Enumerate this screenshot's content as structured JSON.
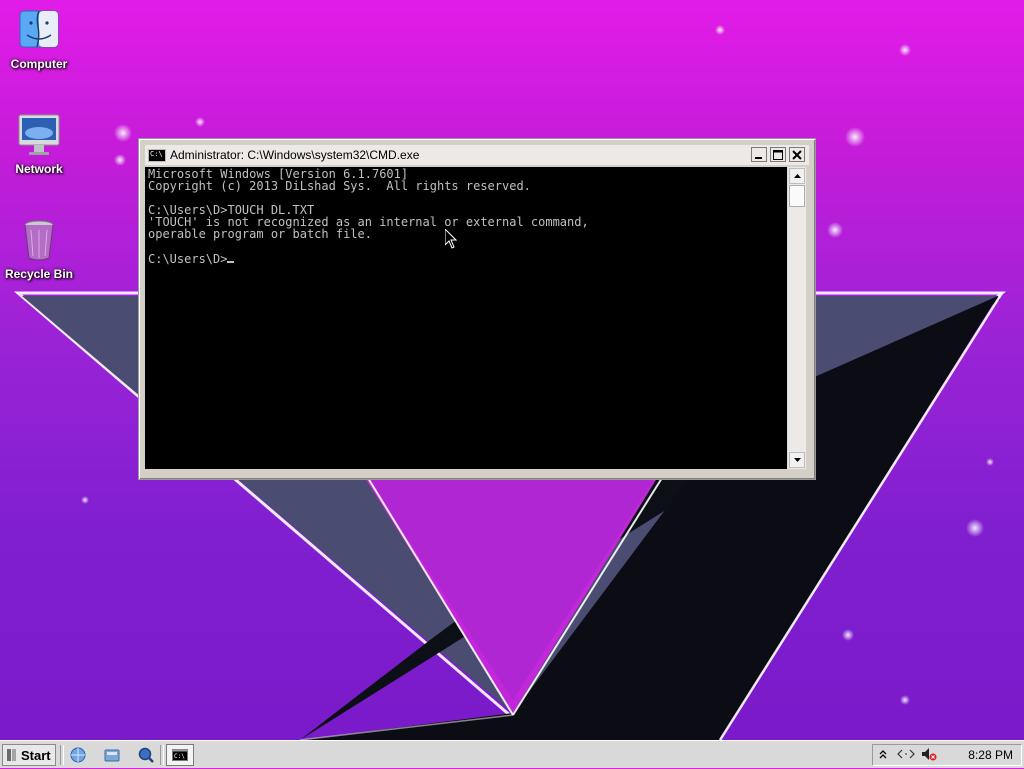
{
  "desktop": {
    "icons": [
      {
        "label": "Computer",
        "icon": "finder-computer-icon"
      },
      {
        "label": "Network",
        "icon": "imac-network-icon"
      },
      {
        "label": "Recycle Bin",
        "icon": "recycle-bin-icon"
      }
    ]
  },
  "window": {
    "title": "Administrator: C:\\Windows\\system32\\CMD.exe",
    "app_icon_text": "C:\\",
    "console_lines": [
      "Microsoft Windows [Version 6.1.7601]",
      "Copyright (c) 2013 DiLshad Sys.  All rights reserved.",
      "",
      "C:\\Users\\D>TOUCH DL.TXT",
      "'TOUCH' is not recognized as an internal or external command,",
      "operable program or batch file.",
      "",
      "C:\\Users\\D>"
    ]
  },
  "taskbar": {
    "start_label": "Start",
    "quick_launch": [
      "browser-icon",
      "explorer-icon",
      "search-icon"
    ],
    "task_items": [
      "cmd-task-icon"
    ],
    "tray_icons": [
      "show-hidden-icons-chevron",
      "network-arrows-icon",
      "volume-muted-icon"
    ],
    "clock": "8:28 PM"
  },
  "colors": {
    "wallpaper_top": "#e21ce8",
    "wallpaper_bottom": "#7a19c8",
    "console_bg": "#000000",
    "console_fg": "#c0c0c0",
    "taskbar_bg": "#d9d9d9"
  }
}
